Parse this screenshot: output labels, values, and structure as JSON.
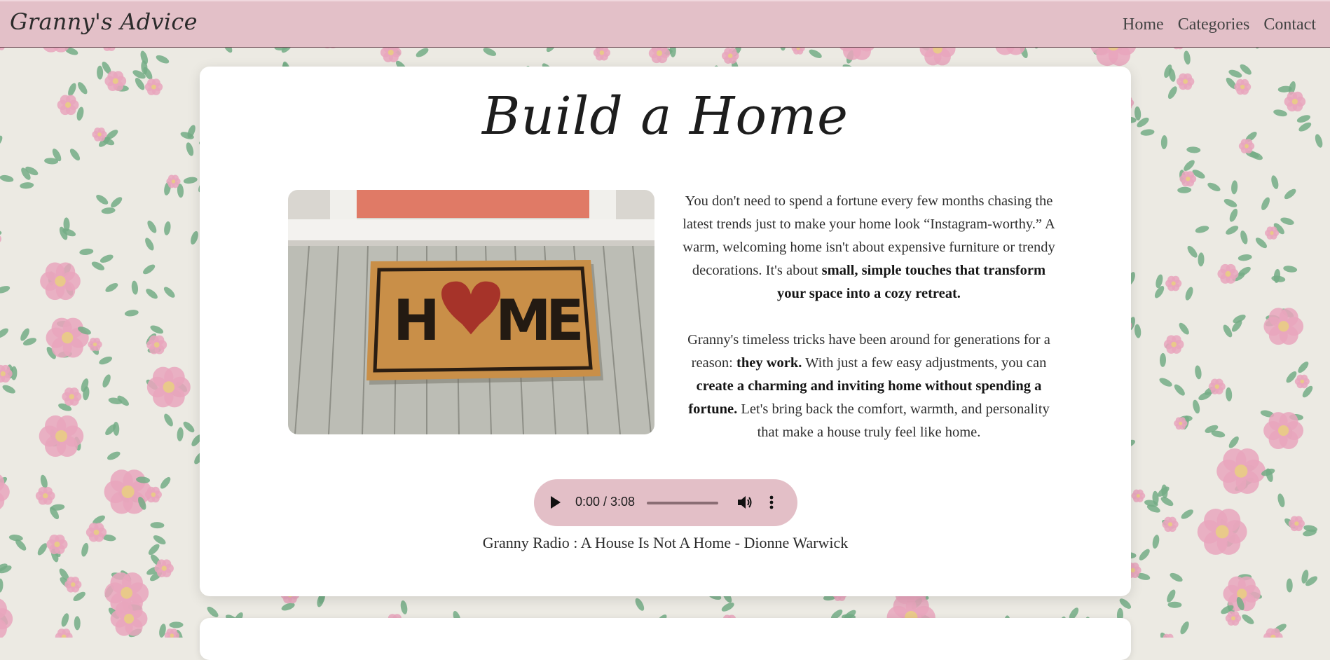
{
  "header": {
    "brand": "Granny's Advice",
    "nav": [
      "Home",
      "Categories",
      "Contact"
    ]
  },
  "article": {
    "title": "Build a Home",
    "image_alt": "Welcome doormat reading HOME with a red heart",
    "doormat_text": "HOME",
    "paragraph1": {
      "text": "You don't need to spend a fortune every few months chasing the latest trends just to make your home look “Instagram-worthy.” A warm, welcoming home isn't about expensive furniture or trendy decorations. It's about ",
      "bold": "small, simple touches that transform your space into a cozy retreat."
    },
    "paragraph2": {
      "part1": "Granny's timeless tricks have been around for generations for a reason: ",
      "bold1": "they work.",
      "part2": " With just a few easy adjustments, you can ",
      "bold2": "create a charming and inviting home without spending a fortune.",
      "part3": " Let's bring back the comfort, warmth, and personality that make a house truly feel like home."
    }
  },
  "audio": {
    "time": "0:00 / 3:08",
    "progress": 0,
    "caption": "Granny Radio : A House Is Not A Home - Dionne Warwick"
  },
  "colors": {
    "header_bg": "#e3c0c8",
    "player_bg": "#e3bfc7",
    "card_bg": "#ffffff",
    "wallpaper_bg": "#eceae3",
    "flower_pink": "#e9a6bd",
    "leaf_green": "#74ad86"
  }
}
